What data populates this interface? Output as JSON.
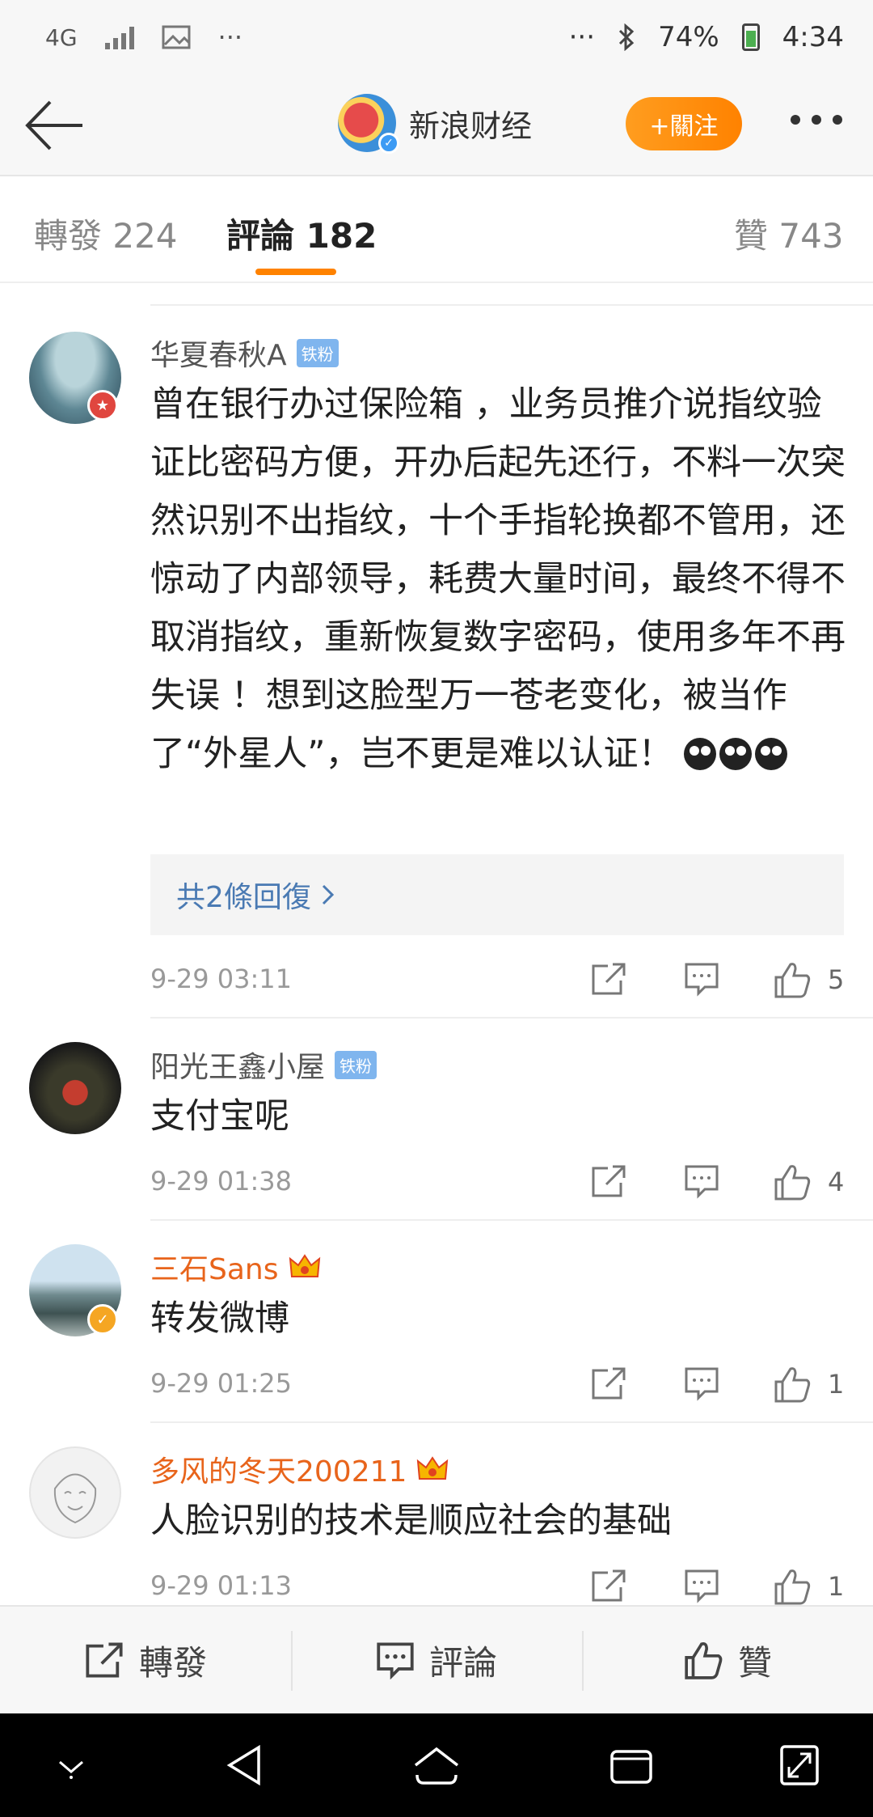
{
  "status_bar": {
    "network": "4G",
    "left_extra": "···",
    "right_extra": "···",
    "battery": "74%",
    "time": "4:34"
  },
  "header": {
    "account_name": "新浪财经",
    "follow_label": "+關注"
  },
  "tabs": [
    {
      "label": "轉發 224"
    },
    {
      "label": "評論 182"
    },
    {
      "label": "贊 743"
    }
  ],
  "comments": [
    {
      "name": "华夏春秋A",
      "badge": "铁粉",
      "text": "曾在银行办过保险箱 ，业务员推介说指纹验证比密码方便，开办后起先还行，不料一次突然识别不出指纹，十个手指轮换都不管用，还惊动了内部领导，耗费大量时间，最终不得不取消指纹，重新恢复数字密码，使用多年不再失误 ！想到这脸型万一苍老变化，被当作了“外星人”，岂不更是难以认证！",
      "replies": "共2條回復",
      "time": "9-29 03:11",
      "likes": "5"
    },
    {
      "name": "阳光王鑫小屋",
      "badge": "铁粉",
      "text": "支付宝呢",
      "time": "9-29 01:38",
      "likes": "4"
    },
    {
      "name": "三石Sans",
      "text": "转发微博",
      "time": "9-29 01:25",
      "likes": "1"
    },
    {
      "name": "多风的冬天200211",
      "text": "人脸识别的技术是顺应社会的基础",
      "time": "9-29 01:13",
      "likes": "1"
    }
  ],
  "bottom_bar": {
    "repost": "轉發",
    "comment": "評論",
    "like": "贊"
  },
  "colors": {
    "accent": "#ff8200",
    "link": "#4a7ab3",
    "vip_name": "#e8641b"
  }
}
